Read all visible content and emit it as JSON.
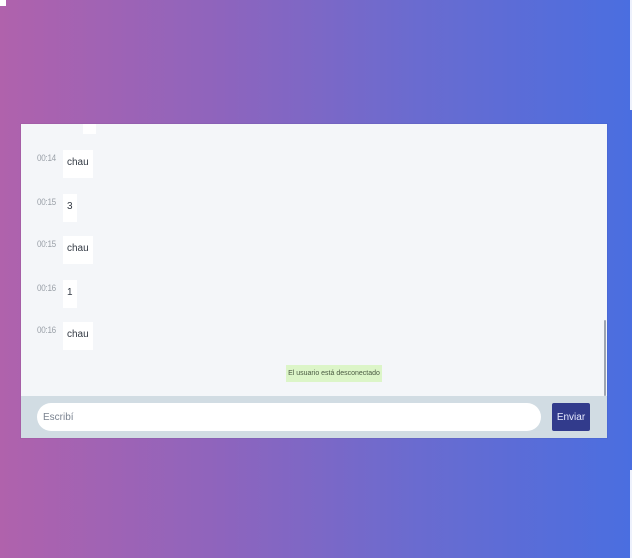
{
  "chat": {
    "messages": [
      {
        "time": "00:14",
        "text": "chau"
      },
      {
        "time": "00:15",
        "text": "3"
      },
      {
        "time": "00:15",
        "text": "chau"
      },
      {
        "time": "00:16",
        "text": "1"
      },
      {
        "time": "00:16",
        "text": "chau"
      }
    ],
    "status": "El usuario está desconectado"
  },
  "composer": {
    "placeholder": "Escribí",
    "send_label": "Enviar"
  },
  "colors": {
    "background_start": "#b062ac",
    "background_end": "#4a6ee0",
    "send_button": "#323b8c",
    "status_badge": "#dcf5c8"
  }
}
